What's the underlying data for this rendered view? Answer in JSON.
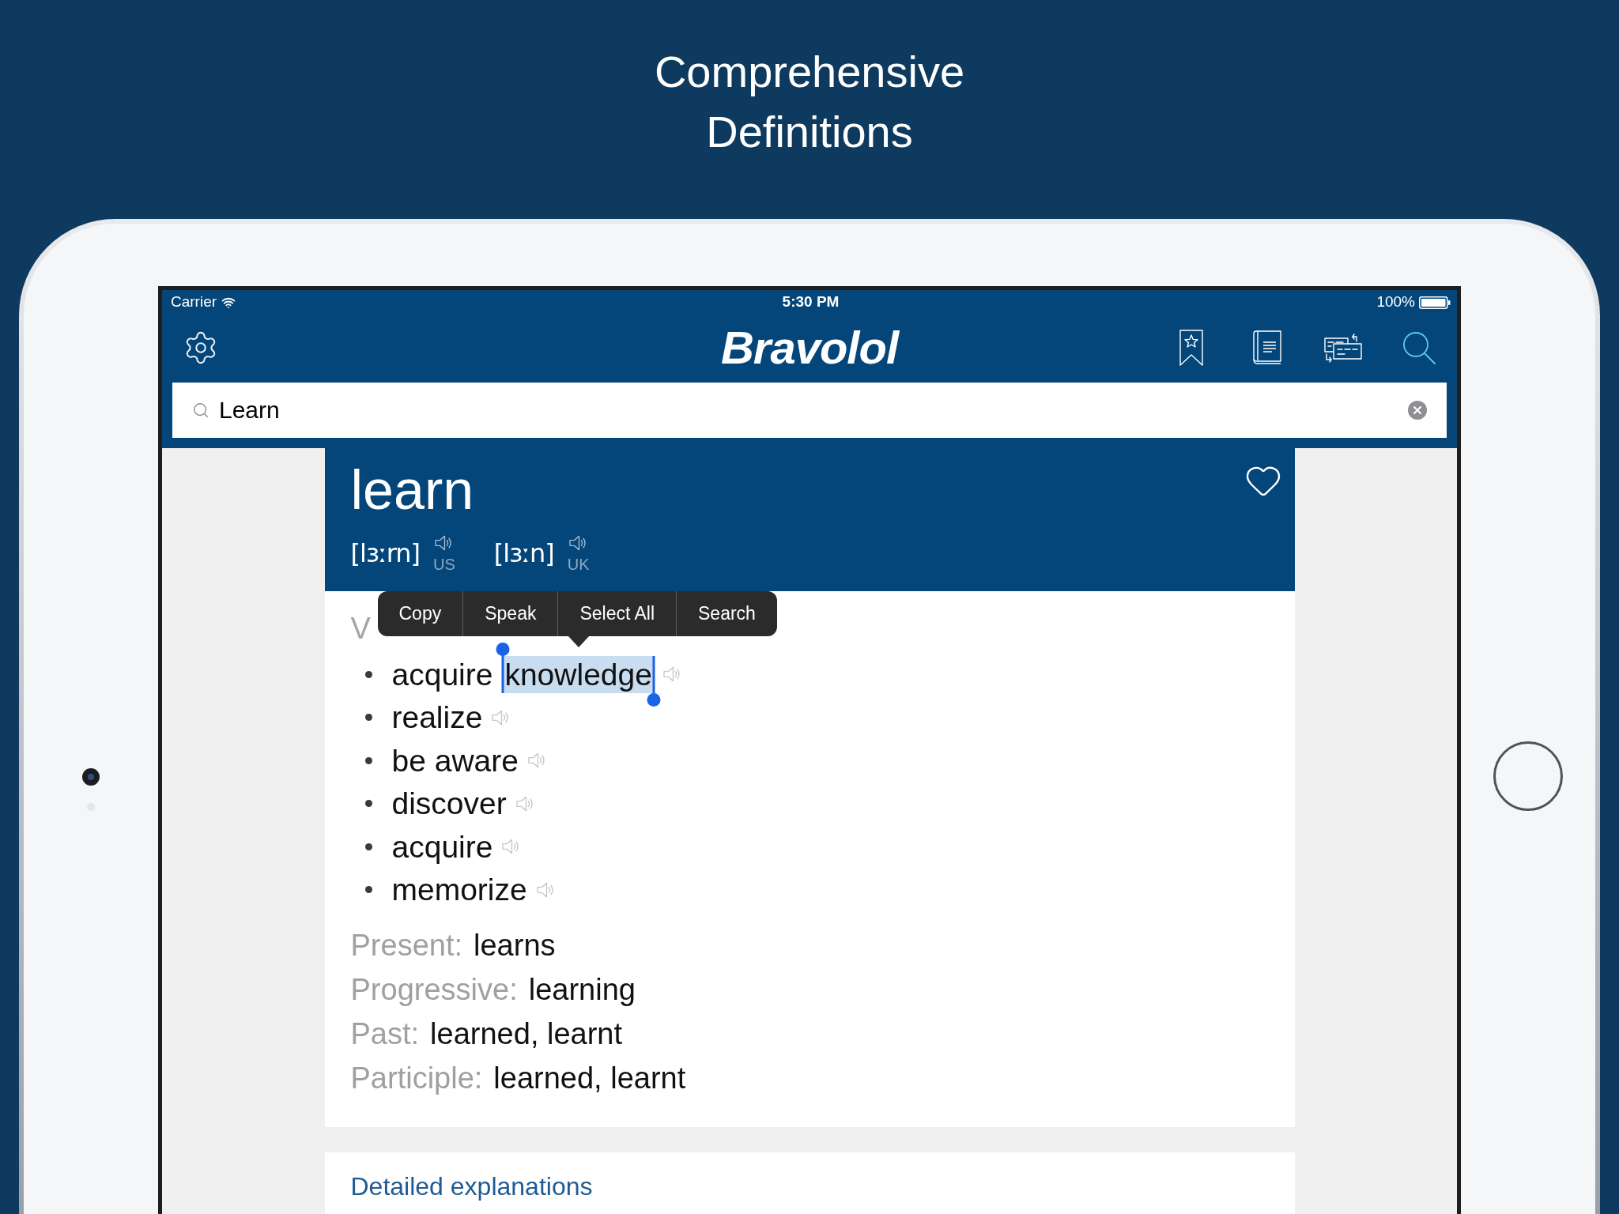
{
  "headline": {
    "lines": [
      "Comprehensive",
      "Definitions"
    ]
  },
  "status_bar": {
    "carrier": "Carrier",
    "time": "5:30 PM",
    "battery": "100%"
  },
  "nav_bar": {
    "logo": "Bravolol",
    "nav_tabs": [
      {
        "kind": "bookmarks",
        "selected": false
      },
      {
        "kind": "book",
        "selected": false
      },
      {
        "kind": "flashcards",
        "selected": false
      },
      {
        "kind": "search",
        "selected": true
      }
    ]
  },
  "search": {
    "value": "Learn"
  },
  "entry": {
    "word": "learn",
    "pronunciations": [
      {
        "ipa": "[lɜːrn]",
        "region": "US"
      },
      {
        "ipa": "[lɜːn]",
        "region": "UK"
      }
    ]
  },
  "senses": [
    {
      "part_of_speech": "V",
      "synonyms": [
        {
          "segments": [
            {
              "text": "acquire",
              "selected": false
            },
            {
              "text": "knowledge",
              "selected": true
            }
          ]
        },
        {
          "segments": [
            {
              "text": "realize",
              "selected": false
            }
          ]
        },
        {
          "segments": [
            {
              "text": "be aware",
              "selected": false
            }
          ]
        },
        {
          "segments": [
            {
              "text": "discover",
              "selected": false
            }
          ]
        },
        {
          "segments": [
            {
              "text": "acquire",
              "selected": false
            }
          ]
        },
        {
          "segments": [
            {
              "text": "memorize",
              "selected": false
            }
          ]
        }
      ]
    }
  ],
  "inflections": [
    {
      "label": "Present:",
      "value": "learns"
    },
    {
      "label": "Progressive:",
      "value": "learning"
    },
    {
      "label": "Past:",
      "value": "learned, learnt"
    },
    {
      "label": "Participle:",
      "value": "learned, learnt"
    }
  ],
  "context_menu": {
    "items": [
      "Copy",
      "Speak",
      "Select All",
      "Search"
    ]
  },
  "more_section": {
    "title": "Detailed explanations"
  }
}
